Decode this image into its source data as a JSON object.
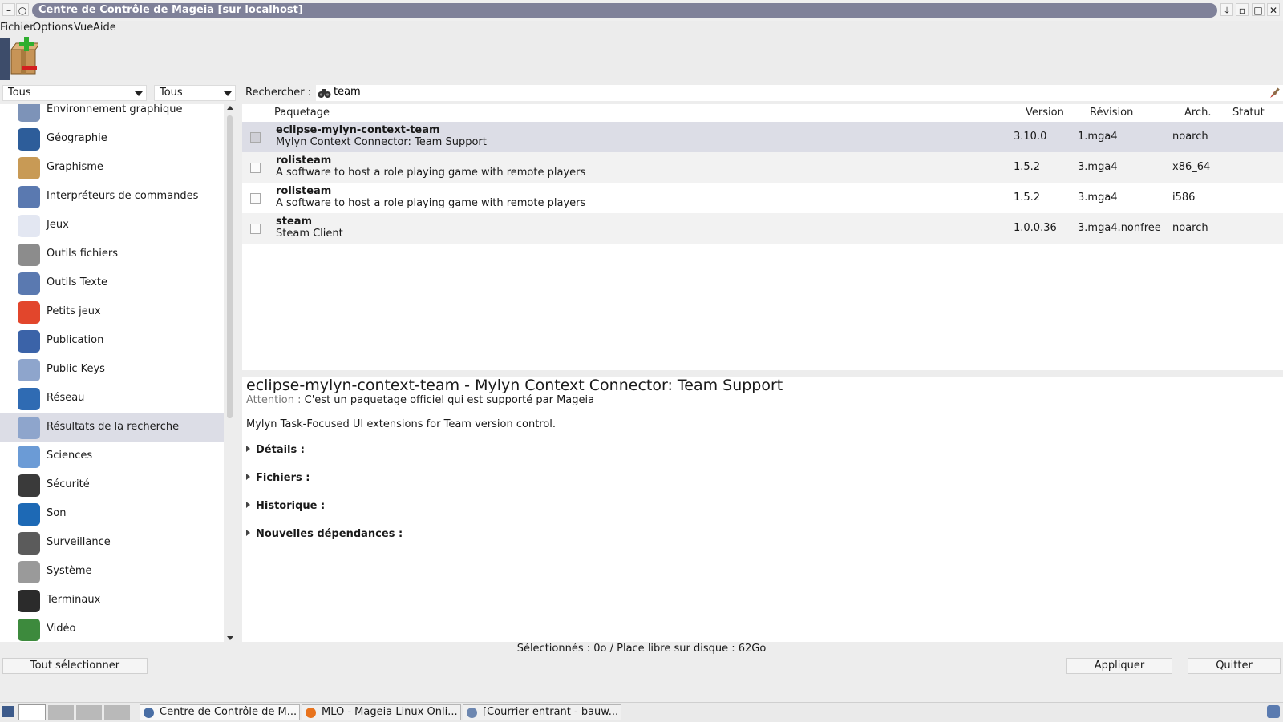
{
  "window": {
    "title": "Centre de Contrôle de Mageia  [sur localhost]",
    "controls": [
      "minimize-button",
      "shade-button",
      "maximize-button",
      "restore-button",
      "close-button"
    ]
  },
  "menu": [
    "Fichier",
    "Options",
    "Vue",
    "Aide"
  ],
  "filters": {
    "combo1": "Tous",
    "combo2": "Tous",
    "search_label": "Rechercher :",
    "search_value": "team"
  },
  "categories": [
    {
      "label": "Environnement graphique",
      "expandable": true,
      "color": "#7d93b8"
    },
    {
      "label": "Géographie",
      "expandable": false,
      "color": "#2d5d9a"
    },
    {
      "label": "Graphisme",
      "expandable": true,
      "color": "#c89a55"
    },
    {
      "label": "Interpréteurs de commandes",
      "expandable": false,
      "color": "#5a79b0"
    },
    {
      "label": "Jeux",
      "expandable": true,
      "color": "#e3e7f2"
    },
    {
      "label": "Outils fichiers",
      "expandable": false,
      "color": "#8c8c8c"
    },
    {
      "label": "Outils Texte",
      "expandable": false,
      "color": "#5a79b0"
    },
    {
      "label": "Petits jeux",
      "expandable": false,
      "color": "#e2462c"
    },
    {
      "label": "Publication",
      "expandable": false,
      "color": "#3b63a8"
    },
    {
      "label": "Public Keys",
      "expandable": false,
      "color": "#8ea5cc"
    },
    {
      "label": "Réseau",
      "expandable": true,
      "color": "#2f6bb3"
    },
    {
      "label": "Résultats de la recherche",
      "expandable": false,
      "color": "#8ea5cc",
      "selected": true
    },
    {
      "label": "Sciences",
      "expandable": true,
      "color": "#6b9bd6"
    },
    {
      "label": "Sécurité",
      "expandable": false,
      "color": "#3a3a3a"
    },
    {
      "label": "Son",
      "expandable": true,
      "color": "#1d69b5"
    },
    {
      "label": "Surveillance",
      "expandable": false,
      "color": "#5b5b5b"
    },
    {
      "label": "Système",
      "expandable": true,
      "color": "#9a9a9a"
    },
    {
      "label": "Terminaux",
      "expandable": false,
      "color": "#2b2b2b"
    },
    {
      "label": "Vidéo",
      "expandable": true,
      "color": "#3d8a3d"
    }
  ],
  "table": {
    "headers": {
      "package": "Paquetage",
      "version": "Version",
      "revision": "Révision",
      "arch": "Arch.",
      "status": "Statut"
    },
    "rows": [
      {
        "name": "eclipse-mylyn-context-team",
        "summary": "Mylyn Context Connector: Team Support",
        "version": "3.10.0",
        "revision": "1.mga4",
        "arch": "noarch",
        "selected": true
      },
      {
        "name": "rolisteam",
        "summary": "A software to host a role playing game with remote players",
        "version": "1.5.2",
        "revision": "3.mga4",
        "arch": "x86_64"
      },
      {
        "name": "rolisteam",
        "summary": "A software to host a role playing game with remote players",
        "version": "1.5.2",
        "revision": "3.mga4",
        "arch": "i586"
      },
      {
        "name": "steam",
        "summary": "Steam Client",
        "version": "1.0.0.36",
        "revision": "3.mga4.nonfree",
        "arch": "noarch"
      }
    ]
  },
  "details": {
    "title": "eclipse-mylyn-context-team - Mylyn Context Connector: Team Support",
    "warning_label": "Attention :",
    "warning_text": "C'est un paquetage officiel qui est supporté par Mageia",
    "description": "Mylyn Task-Focused UI extensions for Team version control.",
    "sections": [
      "Détails :",
      "Fichiers :",
      "Historique :",
      "Nouvelles dépendances :"
    ]
  },
  "status": "Sélectionnés : 0o / Place libre sur disque : 62Go",
  "buttons": {
    "select_all": "Tout sélectionner",
    "apply": "Appliquer",
    "quit": "Quitter"
  },
  "taskbar": {
    "tasks": [
      {
        "label": "Centre de Contrôle de M...",
        "color": "#4a6fa5"
      },
      {
        "label": "MLO - Mageia Linux Onli...",
        "color": "#e8731d"
      },
      {
        "label": "[Courrier entrant - bauw...",
        "color": "#6d87b0"
      }
    ]
  }
}
